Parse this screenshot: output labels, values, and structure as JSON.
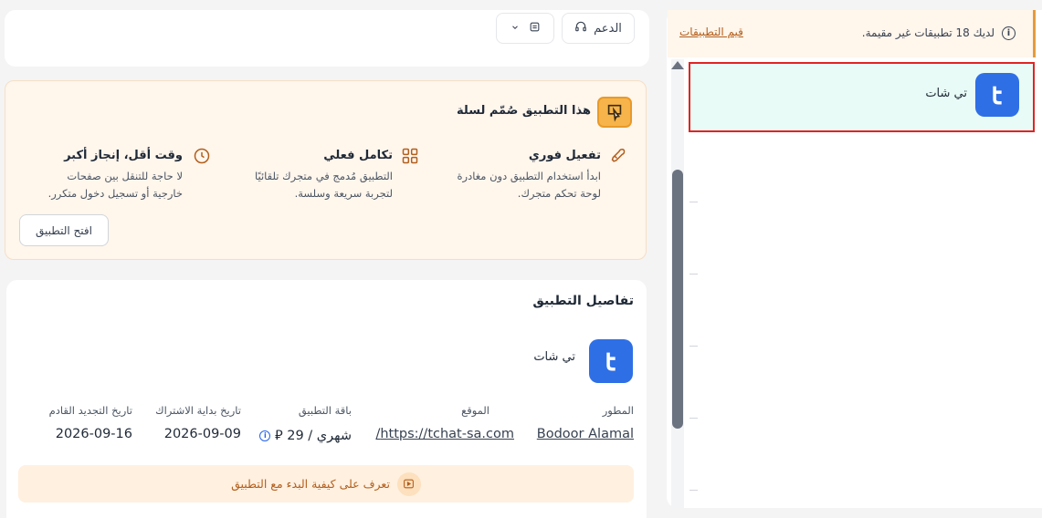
{
  "toolbar": {
    "support_label": "الدعم",
    "dropdown_icon": "calendar-icon"
  },
  "promo": {
    "title": "هذا التطبيق صُمّم لسلة",
    "features": [
      {
        "title": "تفعيل فوري",
        "desc_line1": "ابدأ استخدام التطبيق دون مغادرة",
        "desc_line2": "لوحة تحكم متجرك.",
        "icon": "rocket-icon"
      },
      {
        "title": "تكامل فعلي",
        "desc_line1": "التطبيق مُدمج في متجرك تلقائيًا",
        "desc_line2": "لتجربة سريعة وسلسة.",
        "icon": "grid-icon"
      },
      {
        "title": "وقت أقل، إنجاز أكبر",
        "desc_line1": "لا حاجة للتنقل بين صفحات",
        "desc_line2": "خارجية أو تسجيل دخول متكرر.",
        "icon": "clock-icon"
      }
    ],
    "open_button": "افتح التطبيق"
  },
  "details": {
    "title": "تفاصيل التطبيق",
    "app_name": "تي شات",
    "columns": [
      {
        "label": "المطور",
        "value": "Bodoor Alamal"
      },
      {
        "label": "الموقع",
        "value": "https://tchat-sa.com/"
      },
      {
        "label": "باقة التطبيق",
        "value": "شهري / 29 ⃁"
      },
      {
        "label": "تاريخ بداية الاشتراك",
        "value": "2026-09-09"
      },
      {
        "label": "تاريخ التجديد القادم",
        "value": "2026-09-16"
      }
    ],
    "learn_label": "تعرف على كيفية البدء مع التطبيق"
  },
  "notice": {
    "text": "لديك 18 تطبيقات غير مقيمة.",
    "link": "قيم التطبيقات"
  },
  "apps_list": [
    {
      "name": "تي شات"
    }
  ],
  "colors": {
    "accent": "#e59b3c",
    "brand_blue": "#2f6fe6",
    "selected_row": "#e9fbf6",
    "highlight_border": "#e02424"
  }
}
